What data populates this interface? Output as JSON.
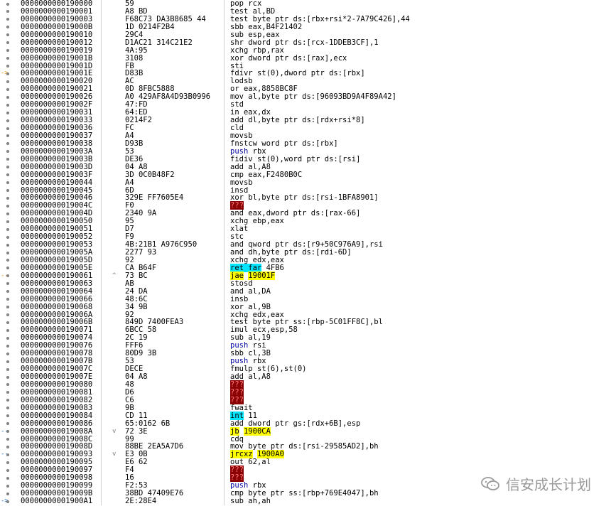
{
  "window": {
    "title": ""
  },
  "watermark": {
    "text": "信安成长计划",
    "icon": "wechat-logo-icon"
  },
  "colors": {
    "background": "#ffffff",
    "address_highlight": "#000000",
    "ret_highlight": "#00e5ff",
    "jump_highlight": "#ffff00",
    "bad_highlight": "#8b0000",
    "push_text": "#0000a0",
    "gutter_dot": "#808080",
    "branch_arrow": "#1565c0"
  },
  "rows": [
    {
      "addr": "0000000000190000",
      "jmp": "",
      "bytes": "59",
      "mn": "pop",
      "ops": "rcx",
      "style": "",
      "mark": "dot"
    },
    {
      "addr": "0000000000190001",
      "jmp": "",
      "bytes": "A8 BD",
      "mn": "test",
      "ops": "al,BD",
      "style": "",
      "mark": "dot"
    },
    {
      "addr": "0000000000190003",
      "jmp": "",
      "bytes": "F68C73 DA3B8685 44",
      "mn": "test",
      "ops": "byte ptr ds:[rbx+rsi*2-7A79C426],44",
      "style": "",
      "mark": "dot"
    },
    {
      "addr": "000000000019000B",
      "jmp": "",
      "bytes": "1D 0214F2B4",
      "mn": "sbb",
      "ops": "eax,B4F21402",
      "style": "",
      "mark": "dot"
    },
    {
      "addr": "0000000000190010",
      "jmp": "",
      "bytes": "29C4",
      "mn": "sub",
      "ops": "esp,eax",
      "style": "",
      "mark": "dot"
    },
    {
      "addr": "0000000000190012",
      "jmp": "",
      "bytes": "D1AC21 314C21E2",
      "mn": "shr",
      "ops": "dword ptr ds:[rcx-1DDEB3CF],1",
      "style": "",
      "mark": "dot"
    },
    {
      "addr": "0000000000190019",
      "jmp": "",
      "bytes": "4A:95",
      "mn": "xchg",
      "ops": "rbp,rax",
      "style": "",
      "mark": "dot"
    },
    {
      "addr": "000000000019001B",
      "jmp": "",
      "bytes": "3108",
      "mn": "xor",
      "ops": "dword ptr ds:[rax],ecx",
      "style": "",
      "mark": "dot"
    },
    {
      "addr": "000000000019001D",
      "jmp": "",
      "bytes": "FB",
      "mn": "sti",
      "ops": "",
      "style": "",
      "mark": "dot"
    },
    {
      "addr": "000000000019001E",
      "jmp": "",
      "bytes": "D83B",
      "mn": "fdivr",
      "ops": "st(0),dword ptr ds:[rbx]",
      "style": "",
      "mark": "arrow-orange"
    },
    {
      "addr": "0000000000190020",
      "jmp": "",
      "bytes": "AC",
      "mn": "lodsb",
      "ops": "",
      "style": "",
      "mark": "dot"
    },
    {
      "addr": "0000000000190021",
      "jmp": "",
      "bytes": "0D 8FBC5888",
      "mn": "or",
      "ops": "eax,8858BC8F",
      "style": "",
      "mark": "dot"
    },
    {
      "addr": "0000000000190026",
      "jmp": "",
      "bytes": "A0 429AF8A4D93B0996",
      "mn": "mov",
      "ops": "al,byte ptr ds:[96093BD9A4F89A42]",
      "style": "",
      "mark": "dot"
    },
    {
      "addr": "000000000019002F",
      "jmp": "",
      "bytes": "47:FD",
      "mn": "std",
      "ops": "",
      "style": "",
      "mark": "dot"
    },
    {
      "addr": "0000000000190031",
      "jmp": "",
      "bytes": "64:ED",
      "mn": "in",
      "ops": "eax,dx",
      "style": "",
      "mark": "dot"
    },
    {
      "addr": "0000000000190033",
      "jmp": "",
      "bytes": "0214F2",
      "mn": "add",
      "ops": "dl,byte ptr ds:[rdx+rsi*8]",
      "style": "",
      "mark": "dot"
    },
    {
      "addr": "0000000000190036",
      "jmp": "",
      "bytes": "FC",
      "mn": "cld",
      "ops": "",
      "style": "",
      "mark": "dot"
    },
    {
      "addr": "0000000000190037",
      "jmp": "",
      "bytes": "A4",
      "mn": "movsb",
      "ops": "",
      "style": "",
      "mark": "dot"
    },
    {
      "addr": "0000000000190038",
      "jmp": "",
      "bytes": "D93B",
      "mn": "fnstcw",
      "ops": "word ptr ds:[rbx]",
      "style": "",
      "mark": "dot"
    },
    {
      "addr": "000000000019003A",
      "jmp": "",
      "bytes": "53",
      "mn": "push",
      "ops": "rbx",
      "style": "push",
      "mark": "dot"
    },
    {
      "addr": "000000000019003B",
      "jmp": "",
      "bytes": "DE36",
      "mn": "fidiv",
      "ops": "st(0),word ptr ds:[rsi]",
      "style": "",
      "mark": "dot"
    },
    {
      "addr": "000000000019003D",
      "jmp": "",
      "bytes": "04 A8",
      "mn": "add",
      "ops": "al,A8",
      "style": "",
      "mark": "dot"
    },
    {
      "addr": "000000000019003F",
      "jmp": "",
      "bytes": "3D 0C0B48F2",
      "mn": "cmp",
      "ops": "eax,F2480B0C",
      "style": "",
      "mark": "dot"
    },
    {
      "addr": "0000000000190044",
      "jmp": "",
      "bytes": "A4",
      "mn": "movsb",
      "ops": "",
      "style": "",
      "mark": "dot"
    },
    {
      "addr": "0000000000190045",
      "jmp": "",
      "bytes": "6D",
      "mn": "insd",
      "ops": "",
      "style": "",
      "mark": "dot"
    },
    {
      "addr": "0000000000190046",
      "jmp": "",
      "bytes": "329E FF7605E4",
      "mn": "xor",
      "ops": "bl,byte ptr ds:[rsi-1BFA8901]",
      "style": "",
      "mark": "dot"
    },
    {
      "addr": "000000000019004C",
      "jmp": "",
      "bytes": "F0",
      "mn": "???",
      "ops": "",
      "style": "bad",
      "mark": "dot"
    },
    {
      "addr": "000000000019004D",
      "jmp": "",
      "bytes": "2340 9A",
      "mn": "and",
      "ops": "eax,dword ptr ds:[rax-66]",
      "style": "",
      "mark": "dot"
    },
    {
      "addr": "0000000000190050",
      "jmp": "",
      "bytes": "95",
      "mn": "xchg",
      "ops": "ebp,eax",
      "style": "",
      "mark": "dot"
    },
    {
      "addr": "0000000000190051",
      "jmp": "",
      "bytes": "D7",
      "mn": "xlat",
      "ops": "",
      "style": "",
      "mark": "dot"
    },
    {
      "addr": "0000000000190052",
      "jmp": "",
      "bytes": "F9",
      "mn": "stc",
      "ops": "",
      "style": "",
      "mark": "dot"
    },
    {
      "addr": "0000000000190053",
      "jmp": "",
      "bytes": "4B:21B1 A976C950",
      "mn": "and",
      "ops": "qword ptr ds:[r9+50C976A9],rsi",
      "style": "",
      "mark": "dot"
    },
    {
      "addr": "000000000019005A",
      "jmp": "",
      "bytes": "2277 93",
      "mn": "and",
      "ops": "dh,byte ptr ds:[rdi-6D]",
      "style": "",
      "mark": "dot"
    },
    {
      "addr": "000000000019005D",
      "jmp": "",
      "bytes": "92",
      "mn": "xchg",
      "ops": "edx,eax",
      "style": "",
      "mark": "dot"
    },
    {
      "addr": "000000000019005E",
      "jmp": "",
      "bytes": "CA B64F",
      "mn": "ret far",
      "ops": "4FB6",
      "style": "ret",
      "mark": "dot"
    },
    {
      "addr": "0000000000190061",
      "jmp": "^",
      "bytes": "73 BC",
      "mn": "jae",
      "ops": "19001F",
      "style": "jcc",
      "mark": "arrow-orange-dash"
    },
    {
      "addr": "0000000000190063",
      "jmp": "",
      "bytes": "AB",
      "mn": "stosd",
      "ops": "",
      "style": "",
      "mark": "dot"
    },
    {
      "addr": "0000000000190064",
      "jmp": "",
      "bytes": "24 DA",
      "mn": "and",
      "ops": "al,DA",
      "style": "",
      "mark": "dot"
    },
    {
      "addr": "0000000000190066",
      "jmp": "",
      "bytes": "48:6C",
      "mn": "insb",
      "ops": "",
      "style": "",
      "mark": "dot"
    },
    {
      "addr": "0000000000190068",
      "jmp": "",
      "bytes": "34 9B",
      "mn": "xor",
      "ops": "al,9B",
      "style": "",
      "mark": "dot"
    },
    {
      "addr": "000000000019006A",
      "jmp": "",
      "bytes": "92",
      "mn": "xchg",
      "ops": "edx,eax",
      "style": "",
      "mark": "dot"
    },
    {
      "addr": "000000000019006B",
      "jmp": "",
      "bytes": "849D 7400FEA3",
      "mn": "test",
      "ops": "byte ptr ss:[rbp-5C01FF8C],bl",
      "style": "seg-ss",
      "mark": "dot"
    },
    {
      "addr": "0000000000190071",
      "jmp": "",
      "bytes": "6BCC 58",
      "mn": "imul",
      "ops": "ecx,esp,58",
      "style": "",
      "mark": "dot"
    },
    {
      "addr": "0000000000190074",
      "jmp": "",
      "bytes": "2C 19",
      "mn": "sub",
      "ops": "al,19",
      "style": "",
      "mark": "dot"
    },
    {
      "addr": "0000000000190076",
      "jmp": "",
      "bytes": "FFF6",
      "mn": "push",
      "ops": "rsi",
      "style": "push",
      "mark": "dot"
    },
    {
      "addr": "0000000000190078",
      "jmp": "",
      "bytes": "80D9 3B",
      "mn": "sbb",
      "ops": "cl,3B",
      "style": "",
      "mark": "dot"
    },
    {
      "addr": "000000000019007B",
      "jmp": "",
      "bytes": "53",
      "mn": "push",
      "ops": "rbx",
      "style": "push",
      "mark": "dot"
    },
    {
      "addr": "000000000019007C",
      "jmp": "",
      "bytes": "DECE",
      "mn": "fmulp",
      "ops": "st(6),st(0)",
      "style": "",
      "mark": "dot"
    },
    {
      "addr": "000000000019007E",
      "jmp": "",
      "bytes": "04 A8",
      "mn": "add",
      "ops": "al,A8",
      "style": "",
      "mark": "dot"
    },
    {
      "addr": "0000000000190080",
      "jmp": "",
      "bytes": "48",
      "mn": "???",
      "ops": "",
      "style": "bad",
      "mark": "dot"
    },
    {
      "addr": "0000000000190081",
      "jmp": "",
      "bytes": "D6",
      "mn": "???",
      "ops": "",
      "style": "bad",
      "mark": "dot"
    },
    {
      "addr": "0000000000190082",
      "jmp": "",
      "bytes": "C6",
      "mn": "???",
      "ops": "",
      "style": "bad",
      "mark": "dot"
    },
    {
      "addr": "0000000000190083",
      "jmp": "",
      "bytes": "9B",
      "mn": "fwait",
      "ops": "",
      "style": "",
      "mark": "dot"
    },
    {
      "addr": "0000000000190084",
      "jmp": "",
      "bytes": "CD 11",
      "mn": "int",
      "ops": "11",
      "style": "int",
      "mark": "dot"
    },
    {
      "addr": "0000000000190086",
      "jmp": "",
      "bytes": "65:0162 6B",
      "mn": "add",
      "ops": "dword ptr gs:[rdx+6B],esp",
      "style": "seg-gs",
      "mark": "dot"
    },
    {
      "addr": "000000000019008A",
      "jmp": "v",
      "bytes": "72 3E",
      "mn": "jb",
      "ops": "1900CA",
      "style": "jcc",
      "mark": "arrow-blue-dash"
    },
    {
      "addr": "000000000019008C",
      "jmp": "",
      "bytes": "99",
      "mn": "cdq",
      "ops": "",
      "style": "",
      "mark": "dot"
    },
    {
      "addr": "000000000019008D",
      "jmp": "",
      "bytes": "88BE 2EA5A7D6",
      "mn": "mov",
      "ops": "byte ptr ds:[rsi-29585AD2],bh",
      "style": "",
      "mark": "dot"
    },
    {
      "addr": "0000000000190093",
      "jmp": "v",
      "bytes": "E3 0B",
      "mn": "jrcxz",
      "ops": "1900A0",
      "style": "jcc",
      "mark": "arrow-blue-dash"
    },
    {
      "addr": "0000000000190095",
      "jmp": "",
      "bytes": "E6 62",
      "mn": "out",
      "ops": "62,al",
      "style": "",
      "mark": "dot"
    },
    {
      "addr": "0000000000190097",
      "jmp": "",
      "bytes": "F4",
      "mn": "???",
      "ops": "",
      "style": "bad",
      "mark": "dot"
    },
    {
      "addr": "0000000000190098",
      "jmp": "",
      "bytes": "16",
      "mn": "???",
      "ops": "",
      "style": "bad",
      "mark": "dot"
    },
    {
      "addr": "0000000000190099",
      "jmp": "",
      "bytes": "F2:53",
      "mn": "push",
      "ops": "rbx",
      "style": "push",
      "mark": "dot"
    },
    {
      "addr": "000000000019009B",
      "jmp": "",
      "bytes": "38BD 47409E76",
      "mn": "cmp",
      "ops": "byte ptr ss:[rbp+769E4047],bh",
      "style": "seg-ss",
      "mark": "dot"
    },
    {
      "addr": "00000000001900A1",
      "jmp": "",
      "bytes": "2E:28E4",
      "mn": "sub",
      "ops": "ah,ah",
      "style": "",
      "mark": "arrow-blue"
    }
  ]
}
